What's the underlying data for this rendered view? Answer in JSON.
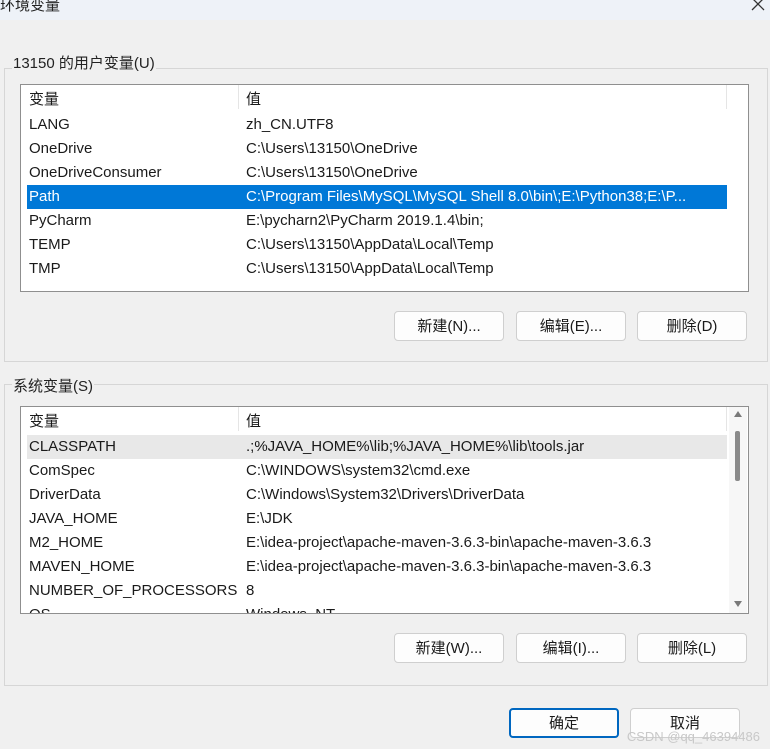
{
  "window": {
    "title": "环境变量",
    "close_icon": "close-icon"
  },
  "user_vars": {
    "label": "13150 的用户变量(U)",
    "headers": {
      "name": "变量",
      "value": "值"
    },
    "rows": [
      {
        "name": "LANG",
        "value": "zh_CN.UTF8"
      },
      {
        "name": "OneDrive",
        "value": "C:\\Users\\13150\\OneDrive"
      },
      {
        "name": "OneDriveConsumer",
        "value": "C:\\Users\\13150\\OneDrive"
      },
      {
        "name": "Path",
        "value": "C:\\Program Files\\MySQL\\MySQL Shell 8.0\\bin\\;E:\\Python38;E:\\P...",
        "selected": true
      },
      {
        "name": "PyCharm",
        "value": "E:\\pycharn2\\PyCharm 2019.1.4\\bin;"
      },
      {
        "name": "TEMP",
        "value": "C:\\Users\\13150\\AppData\\Local\\Temp"
      },
      {
        "name": "TMP",
        "value": "C:\\Users\\13150\\AppData\\Local\\Temp"
      }
    ],
    "buttons": {
      "new": "新建(N)...",
      "edit": "编辑(E)...",
      "delete": "删除(D)"
    }
  },
  "system_vars": {
    "label": "系统变量(S)",
    "headers": {
      "name": "变量",
      "value": "值"
    },
    "rows": [
      {
        "name": "CLASSPATH",
        "value": ".;%JAVA_HOME%\\lib;%JAVA_HOME%\\lib\\tools.jar",
        "hover": true
      },
      {
        "name": "ComSpec",
        "value": "C:\\WINDOWS\\system32\\cmd.exe"
      },
      {
        "name": "DriverData",
        "value": "C:\\Windows\\System32\\Drivers\\DriverData"
      },
      {
        "name": "JAVA_HOME",
        "value": "E:\\JDK"
      },
      {
        "name": "M2_HOME",
        "value": "E:\\idea-project\\apache-maven-3.6.3-bin\\apache-maven-3.6.3"
      },
      {
        "name": "MAVEN_HOME",
        "value": "E:\\idea-project\\apache-maven-3.6.3-bin\\apache-maven-3.6.3"
      },
      {
        "name": "NUMBER_OF_PROCESSORS",
        "value": "8"
      },
      {
        "name": "OS",
        "value": "Windows_NT"
      }
    ],
    "buttons": {
      "new": "新建(W)...",
      "edit": "编辑(I)...",
      "delete": "删除(L)"
    }
  },
  "dialog_buttons": {
    "ok": "确定",
    "cancel": "取消"
  },
  "watermark": "CSDN @qq_46394486",
  "colors": {
    "selection": "#0078d7",
    "primary_border": "#0067c0"
  }
}
